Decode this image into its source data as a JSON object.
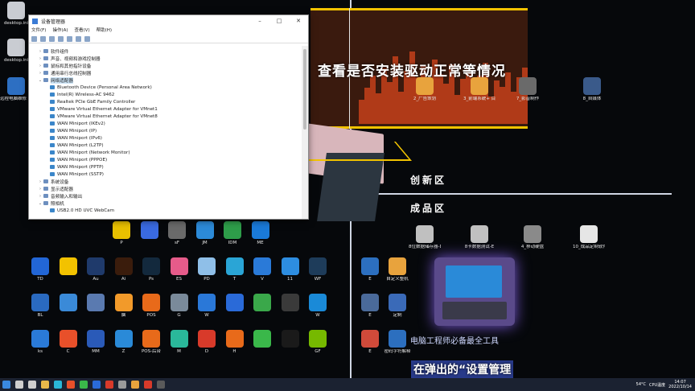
{
  "device_manager": {
    "title": "设备管理器",
    "menu": [
      "文件(F)",
      "操作(A)",
      "查看(V)",
      "帮助(H)"
    ],
    "tree": [
      {
        "label": "软件组件",
        "expanded": false,
        "selected": false,
        "indent": 1
      },
      {
        "label": "声音、视频和游戏控制器",
        "expanded": false,
        "selected": false,
        "indent": 1
      },
      {
        "label": "鼠标和其他指针设备",
        "expanded": false,
        "selected": false,
        "indent": 1
      },
      {
        "label": "通用串行总线控制器",
        "expanded": false,
        "selected": false,
        "indent": 1
      },
      {
        "label": "网络适配器",
        "expanded": true,
        "selected": true,
        "indent": 1
      },
      {
        "label": "Bluetooth Device (Personal Area Network)",
        "indent": 2
      },
      {
        "label": "Intel(R) Wireless-AC 9462",
        "indent": 2
      },
      {
        "label": "Realtek PCIe GbE Family Controller",
        "indent": 2
      },
      {
        "label": "VMware Virtual Ethernet Adapter for VMnet1",
        "indent": 2
      },
      {
        "label": "VMware Virtual Ethernet Adapter for VMnet8",
        "indent": 2
      },
      {
        "label": "WAN Miniport (IKEv2)",
        "indent": 2
      },
      {
        "label": "WAN Miniport (IP)",
        "indent": 2
      },
      {
        "label": "WAN Miniport (IPv6)",
        "indent": 2
      },
      {
        "label": "WAN Miniport (L2TP)",
        "indent": 2
      },
      {
        "label": "WAN Miniport (Network Monitor)",
        "indent": 2
      },
      {
        "label": "WAN Miniport (PPPOE)",
        "indent": 2
      },
      {
        "label": "WAN Miniport (PPTP)",
        "indent": 2
      },
      {
        "label": "WAN Miniport (SSTP)",
        "indent": 2
      },
      {
        "label": "系统设备",
        "expanded": false,
        "indent": 1
      },
      {
        "label": "显示适配器",
        "expanded": false,
        "indent": 1
      },
      {
        "label": "音频输入和输出",
        "expanded": false,
        "indent": 1
      },
      {
        "label": "照相机",
        "expanded": true,
        "indent": 1
      },
      {
        "label": "USB2.0 HD UVC WebCam",
        "indent": 2
      }
    ]
  },
  "overlay": {
    "headline": "查看是否安装驱动正常等情况",
    "caption": "在弹出的“设置管理",
    "tools_line": "电脑工程师必备最全工具"
  },
  "sections": {
    "innovation": "创新区",
    "finished": "成品区"
  },
  "left_icons": [
    {
      "label": "desktop.ini",
      "icon": "file-icon",
      "color": "#c9ccd2"
    },
    {
      "label": "desktop.ini",
      "icon": "file-icon",
      "color": "#c9ccd2"
    },
    {
      "label": "远程电脑维修 PYpc版本v11",
      "icon": "computer-icon",
      "color": "#2d6fc2"
    }
  ],
  "top_right_icons": [
    {
      "label": "2_广告策划",
      "icon": "folder-icon",
      "color": "#e8a33d"
    },
    {
      "label": "3_前端系统+ 目录芯片",
      "icon": "folder-icon",
      "color": "#e8a33d"
    },
    {
      "label": "7_影音制作",
      "icon": "video-icon",
      "color": "#6a6a6a"
    },
    {
      "label": "8_自媒体",
      "icon": "film-icon",
      "color": "#3a5a8a"
    }
  ],
  "finished_icons": [
    {
      "label": "8位数据储存器-D",
      "icon": "usb-icon",
      "color": "#c0c0c0"
    },
    {
      "label": "8卡数据测试-E",
      "icon": "usb-icon",
      "color": "#c0c0c0"
    },
    {
      "label": "4_移动硬盘",
      "icon": "drive-icon",
      "color": "#8a8a8a"
    },
    {
      "label": "10_成品定制软件",
      "icon": "document-icon",
      "color": "#e6e6e6"
    }
  ],
  "mid_right_icons": [
    {
      "label": "E",
      "icon": "app-icon",
      "color": "#2c6fbf"
    },
    {
      "label": "自定义整机",
      "icon": "folder-icon",
      "color": "#e8a33d"
    },
    {
      "label": "E",
      "icon": "gear-icon",
      "color": "#4a6a9a"
    },
    {
      "label": "定制",
      "icon": "grid-icon",
      "color": "#3a6ab8"
    },
    {
      "label": "E",
      "icon": "warning-icon",
      "color": "#d04a3a"
    },
    {
      "label": "密码字符解释",
      "icon": "book-icon",
      "color": "#2c6fbf"
    }
  ],
  "app_rows": [
    [
      {
        "label": "P",
        "color": "#e8c000"
      },
      {
        "label": "",
        "color": "#3a6ae0"
      },
      {
        "label": "sF",
        "color": "#6a6a6a"
      },
      {
        "label": "JM",
        "color": "#2c8ad8"
      },
      {
        "label": "IDM",
        "color": "#2e9d4a"
      },
      {
        "label": "ME",
        "color": "#1a7ad8"
      }
    ],
    [
      {
        "label": "TD",
        "color": "#2266d6"
      },
      {
        "label": "",
        "color": "#f2c200"
      },
      {
        "label": "Au",
        "color": "#1f3a6b"
      },
      {
        "label": "Ai",
        "color": "#3a1c0c"
      },
      {
        "label": "Ps",
        "color": "#13293d"
      },
      {
        "label": "ES",
        "color": "#e65b8a"
      },
      {
        "label": "PD",
        "color": "#8fbfe8"
      },
      {
        "label": "T",
        "color": "#2aa5d6"
      },
      {
        "label": "V",
        "color": "#2a7ad8"
      },
      {
        "label": "11",
        "color": "#2d8de0"
      },
      {
        "label": "WF",
        "color": "#1e3c5a"
      }
    ],
    [
      {
        "label": "BL",
        "color": "#2a6ac0"
      },
      {
        "label": "",
        "color": "#3a8ad8"
      },
      {
        "label": "",
        "color": "#5a7ab0"
      },
      {
        "label": "脑",
        "color": "#f29a2a"
      },
      {
        "label": "POS",
        "color": "#e86a1a"
      },
      {
        "label": "G",
        "color": "#7a8a9a"
      },
      {
        "label": "W",
        "color": "#2a78d8"
      },
      {
        "label": "",
        "color": "#2a6ad8"
      },
      {
        "label": "",
        "color": "#3aa84a"
      },
      {
        "label": "",
        "color": "#3a3a3a"
      },
      {
        "label": "W",
        "color": "#1a8ad8"
      }
    ],
    [
      {
        "label": "ks",
        "color": "#2a7ad8"
      },
      {
        "label": "C",
        "color": "#e8502a"
      },
      {
        "label": "MM",
        "color": "#2a5ab8"
      },
      {
        "label": "Z",
        "color": "#2a8ad8"
      },
      {
        "label": "POS-后台",
        "color": "#e86a1a"
      },
      {
        "label": "M",
        "color": "#2ab89a"
      },
      {
        "label": "D",
        "color": "#d83a2a"
      },
      {
        "label": "H",
        "color": "#e86a1a"
      },
      {
        "label": "",
        "color": "#3ab84a"
      },
      {
        "label": "",
        "color": "#1a1a1a"
      },
      {
        "label": "GF",
        "color": "#76b900"
      }
    ]
  ],
  "taskbar": {
    "weather": "54°C",
    "cpu": "CPU温度",
    "time": "14:07",
    "date": "2022/10/14",
    "apps": [
      {
        "icon": "windows-icon",
        "color": "#3a8ae0"
      },
      {
        "icon": "search-icon",
        "color": "#cfcfcf"
      },
      {
        "icon": "task-view-icon",
        "color": "#cfcfcf"
      },
      {
        "icon": "explorer-icon",
        "color": "#e8b84a"
      },
      {
        "icon": "edge-icon",
        "color": "#2ab8d8"
      },
      {
        "icon": "chrome-icon",
        "color": "#e8502a"
      },
      {
        "icon": "wechat-icon",
        "color": "#3ab84a"
      },
      {
        "icon": "app-icon",
        "color": "#2a6ad8"
      },
      {
        "icon": "app-icon",
        "color": "#d83a2a"
      },
      {
        "icon": "app-icon",
        "color": "#9a9a9a"
      },
      {
        "icon": "app-icon",
        "color": "#e8a33d"
      },
      {
        "icon": "record-icon",
        "color": "#d83a2a"
      },
      {
        "icon": "app-icon",
        "color": "#5a5a5a"
      }
    ]
  }
}
